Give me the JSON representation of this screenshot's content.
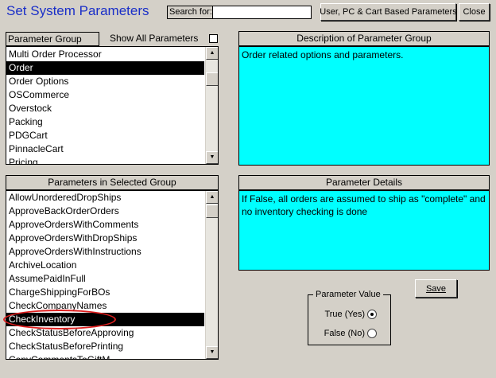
{
  "header": {
    "title": "Set System Parameters",
    "search_label": "Search for:",
    "search_value": "",
    "user_pc_cart_button": "User, PC & Cart Based Parameters",
    "close_button": "Close"
  },
  "parameter_group": {
    "label": "Parameter Group",
    "show_all_label": "Show All Parameters",
    "show_all_checked": false,
    "items": [
      "Multi Order Processor",
      "Order",
      "Order Options",
      "OSCommerce",
      "Overstock",
      "Packing",
      "PDGCart",
      "PinnacleCart",
      "Pricing"
    ],
    "selected": "Order"
  },
  "group_description": {
    "header": "Description of Parameter Group",
    "text": "Order related options and parameters."
  },
  "parameters": {
    "header": "Parameters in Selected Group",
    "items": [
      "AllowUnorderedDropShips",
      "ApproveBackOrderOrders",
      "ApproveOrdersWithComments",
      "ApproveOrdersWithDropShips",
      "ApproveOrdersWithInstructions",
      "ArchiveLocation",
      "AssumePaidInFull",
      "ChargeShippingForBOs",
      "CheckCompanyNames",
      "CheckInventory",
      "CheckStatusBeforeApproving",
      "CheckStatusBeforePrinting",
      "CopyCommentsToGiftM"
    ],
    "selected": "CheckInventory"
  },
  "parameter_details": {
    "header": "Parameter Details",
    "text": "If False, all orders are assumed to ship as \"complete\" and no inventory checking is done"
  },
  "save_button": "Save",
  "parameter_value": {
    "legend": "Parameter Value",
    "true_label": "True (Yes)",
    "false_label": "False (No)",
    "selected": "true"
  },
  "colors": {
    "title": "#1a2fc8",
    "background": "#d4d0c8",
    "description_fill": "#00ffff",
    "selection": "#000000",
    "highlight_ellipse": "#e02020"
  }
}
